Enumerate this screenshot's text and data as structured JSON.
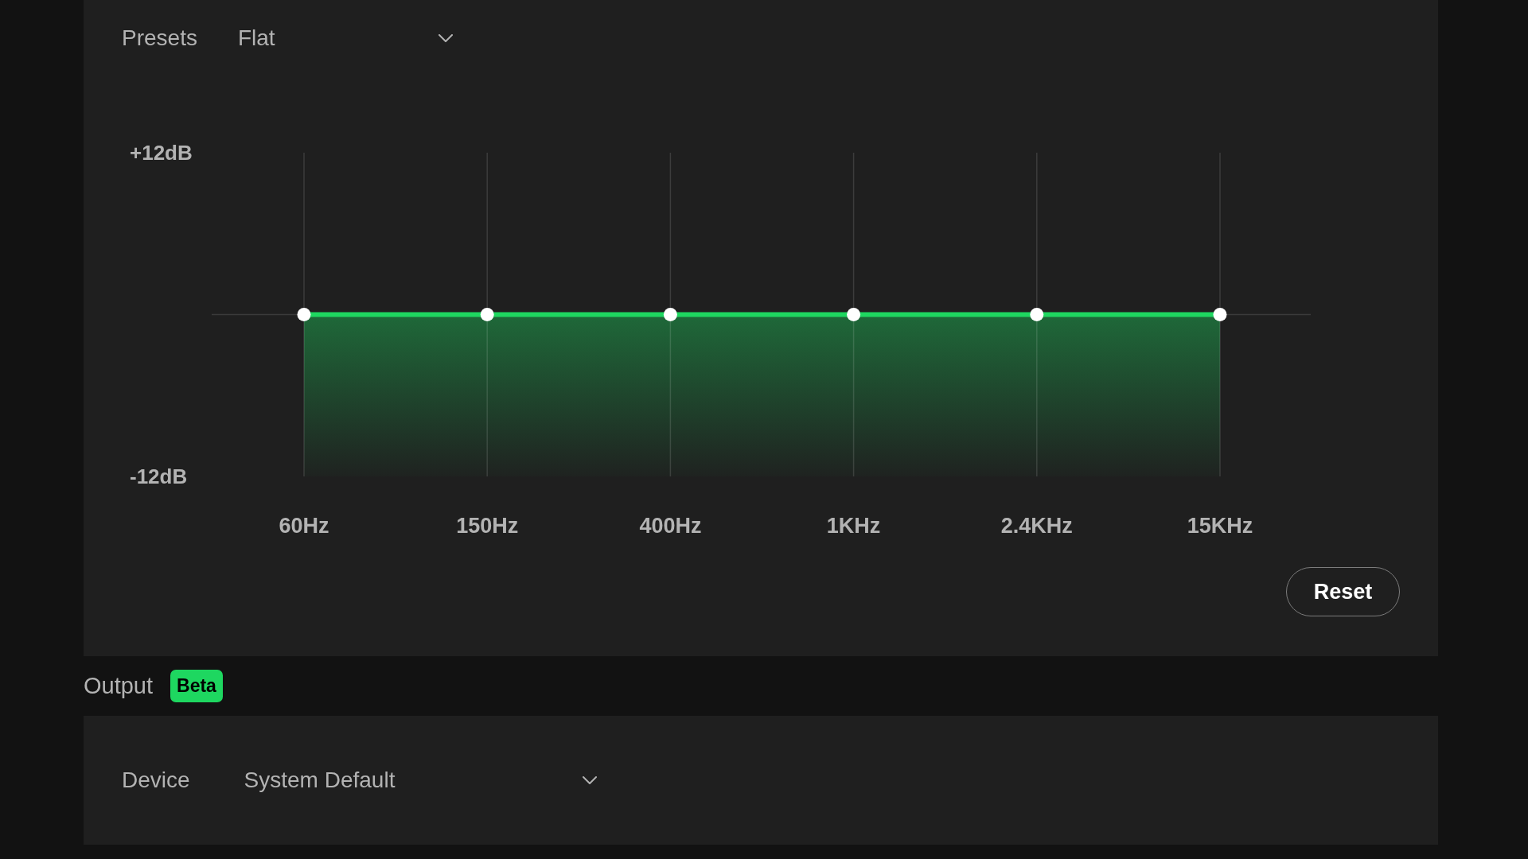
{
  "equalizer": {
    "presets": {
      "label": "Presets",
      "value": "Flat"
    },
    "chart_data": {
      "type": "line",
      "categories": [
        "60Hz",
        "150Hz",
        "400Hz",
        "1KHz",
        "2.4KHz",
        "15KHz"
      ],
      "series": [
        {
          "color": "#1ed760",
          "marker": "o",
          "values": [
            0,
            0,
            0,
            0,
            0,
            0
          ]
        }
      ],
      "ylim": [
        -12,
        12
      ],
      "yticks": [
        {
          "value": 12,
          "label": "+12dB"
        },
        {
          "value": -12,
          "label": "-12dB"
        }
      ],
      "grid": true
    },
    "reset_button": "Reset"
  },
  "output": {
    "title": "Output",
    "badge": "Beta",
    "device": {
      "label": "Device",
      "value": "System Default"
    }
  }
}
